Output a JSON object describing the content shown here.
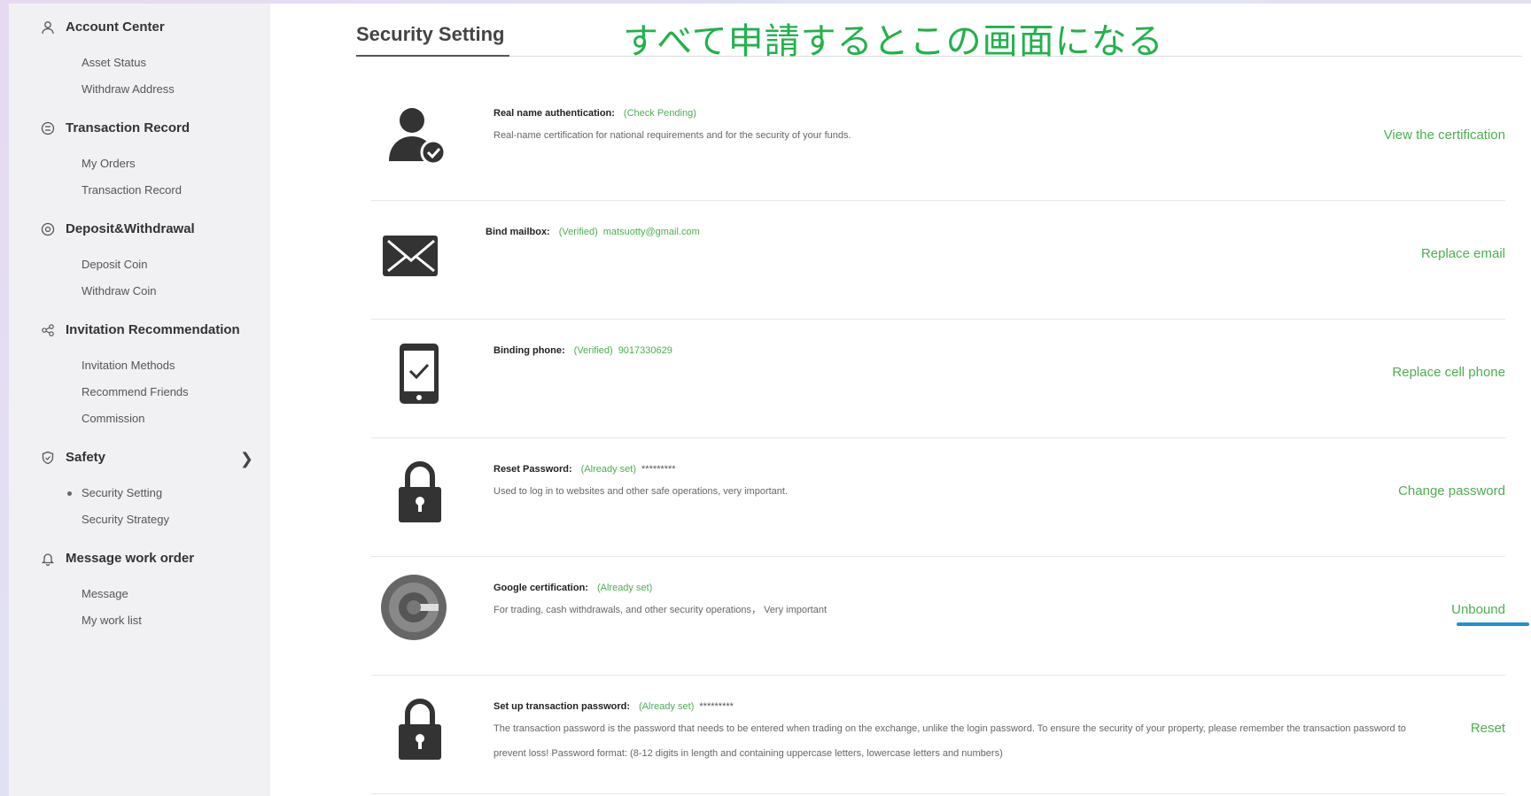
{
  "sidebar": {
    "groups": [
      {
        "title": "Account Center",
        "icon": "user-icon",
        "items": [
          "Asset Status",
          "Withdraw Address"
        ]
      },
      {
        "title": "Transaction Record",
        "icon": "record-icon",
        "items": [
          "My Orders",
          "Transaction Record"
        ]
      },
      {
        "title": "Deposit&Withdrawal",
        "icon": "coin-icon",
        "items": [
          "Deposit Coin",
          "Withdraw Coin"
        ]
      },
      {
        "title": "Invitation Recommendation",
        "icon": "share-icon",
        "items": [
          "Invitation Methods",
          "Recommend Friends",
          "Commission"
        ]
      },
      {
        "title": "Safety",
        "icon": "shield-icon",
        "items": [
          "Security Setting",
          "Security Strategy"
        ]
      },
      {
        "title": "Message work order",
        "icon": "bell-icon",
        "items": [
          "Message",
          "My work list"
        ]
      }
    ],
    "active_item": "Security Setting"
  },
  "header": {
    "tab": "Security Setting",
    "annotation": "すべて申請するとこの画面になる"
  },
  "rows": [
    {
      "key": "Real name authentication:",
      "status": "(Check Pending)",
      "value": "",
      "desc": "Real-name certification for national requirements and for the security of your funds.",
      "action": "View the certification",
      "icon": "verified-user-icon"
    },
    {
      "key": "Bind mailbox:",
      "status": "(Verified)",
      "value": "matsuotty@gmail.com",
      "desc": "",
      "action": "Replace email",
      "icon": "mail-icon"
    },
    {
      "key": "Binding phone:",
      "status": "(Verified)",
      "value": "9017330629",
      "desc": "",
      "action": "Replace cell phone",
      "icon": "phone-check-icon"
    },
    {
      "key": "Reset Password:",
      "status": "(Already set)",
      "value": "*********",
      "desc": "Used to log in to websites and other safe operations, very important.",
      "action": "Change password",
      "icon": "lock-icon"
    },
    {
      "key": "Google certification:",
      "status": "(Already set)",
      "value": "",
      "desc": "For trading, cash withdrawals, and other security operations， Very important",
      "action": "Unbound",
      "icon": "google-authenticator-icon"
    },
    {
      "key": "Set up transaction password:",
      "status": "(Already set)",
      "value": "*********",
      "desc": "The transaction password is the password that needs to be entered when trading on the exchange, unlike the login password. To ensure the security of your property, please remember the transaction password to prevent loss! Password format: (8-12 digits in length and containing uppercase letters, lowercase letters and numbers)",
      "action": "Reset",
      "icon": "lock-icon"
    }
  ],
  "colors": {
    "accent": "#4caf50",
    "annotation": "#22b14c",
    "underline": "#1f8fd6"
  }
}
